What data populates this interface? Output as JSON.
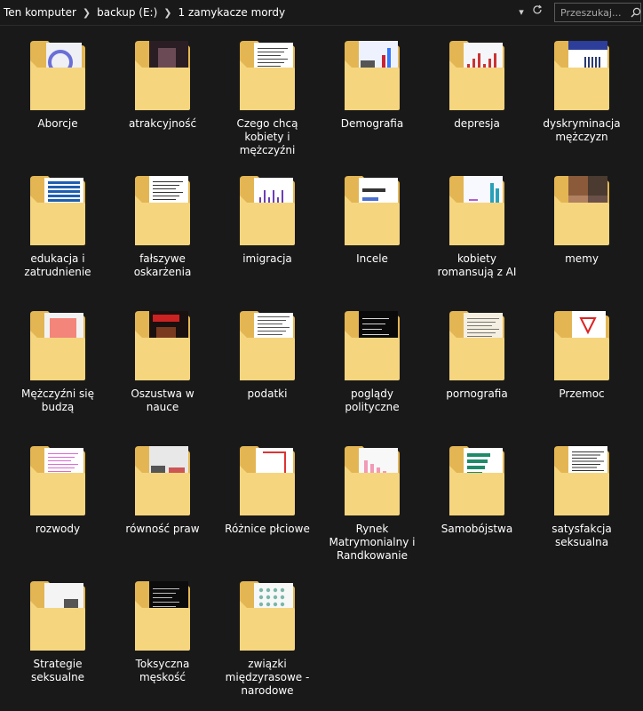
{
  "breadcrumb": {
    "items": [
      "Ten komputer",
      "backup (E:)",
      "1 zamykacze mordy"
    ]
  },
  "search": {
    "placeholder": "Przeszukaj..."
  },
  "colors": {
    "background": "#191919",
    "folder_back": "#e3b653",
    "folder_front": "#f6d57f",
    "text": "#ffffff"
  },
  "folders": [
    {
      "name": "Aborcje",
      "preview": "circle-report"
    },
    {
      "name": "atrakcyjność",
      "preview": "dark-photo"
    },
    {
      "name": "Czego chcą kobiety i mężczyźni",
      "preview": "line-charts"
    },
    {
      "name": "Demografia",
      "preview": "txt-barchart"
    },
    {
      "name": "depresja",
      "preview": "red-bars"
    },
    {
      "name": "dyskryminacja mężczyzn",
      "preview": "blue-report"
    },
    {
      "name": "edukacja i zatrudnienie",
      "preview": "blue-table"
    },
    {
      "name": "fałszywe oskarżenia",
      "preview": "text-doc"
    },
    {
      "name": "imigracja",
      "preview": "purple-charts"
    },
    {
      "name": "Incele",
      "preview": "bar-doc"
    },
    {
      "name": "kobiety romansują z AI",
      "preview": "teal-charts"
    },
    {
      "name": "memy",
      "preview": "photo-collage"
    },
    {
      "name": "Mężczyźni się budzą",
      "preview": "red-chart"
    },
    {
      "name": "Oszustwa w nauce",
      "preview": "poster"
    },
    {
      "name": "podatki",
      "preview": "table-doc"
    },
    {
      "name": "poglądy polityczne",
      "preview": "black-text"
    },
    {
      "name": "pornografia",
      "preview": "table-sheet"
    },
    {
      "name": "Przemoc",
      "preview": "pdf"
    },
    {
      "name": "rozwody",
      "preview": "pink-text"
    },
    {
      "name": "równość praw",
      "preview": "txt-photo"
    },
    {
      "name": "Różnice płciowe",
      "preview": "red-diagram"
    },
    {
      "name": "Rynek Matrymonialny i Randkowanie",
      "preview": "pink-bars"
    },
    {
      "name": "Samobójstwa",
      "preview": "green-bars"
    },
    {
      "name": "satysfakcja seksualna",
      "preview": "dense-text"
    },
    {
      "name": "Strategie seksualne",
      "preview": "gray-doc"
    },
    {
      "name": "Toksyczna męskość",
      "preview": "black-doc"
    },
    {
      "name": "związki międzyrasowe - narodowe",
      "preview": "dot-pattern"
    }
  ]
}
